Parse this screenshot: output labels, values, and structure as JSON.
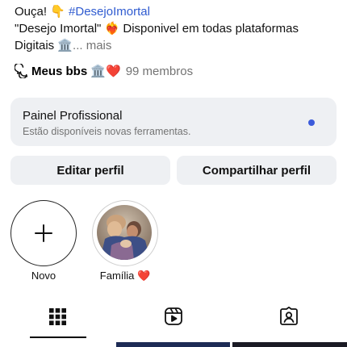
{
  "bio": {
    "line1_prefix": "Ouça! 👇 ",
    "line1_hashtag": "#DesejoImortal",
    "line2": "\"Desejo Imortal\" ❤️‍🔥 Disponivel em todas plataformas",
    "line3_text": "Digitais 🏛️",
    "line3_more": "... mais"
  },
  "community": {
    "name": "Meus bbs 🏛️❤️",
    "members": "99 membros"
  },
  "pro_panel": {
    "title": "Painel Profissional",
    "subtitle": "Estão disponíveis novas ferramentas."
  },
  "buttons": {
    "edit": "Editar perfil",
    "share": "Compartilhar perfil"
  },
  "highlights": [
    {
      "label": "Novo"
    },
    {
      "label": "Família ❤️"
    }
  ],
  "tabs": [
    "grid-icon",
    "reels-icon",
    "tagged-icon"
  ],
  "colors": {
    "accent_link": "#2f5bd0",
    "panel_bg": "#eef0f3",
    "notification_dot": "#3b5bdb"
  }
}
